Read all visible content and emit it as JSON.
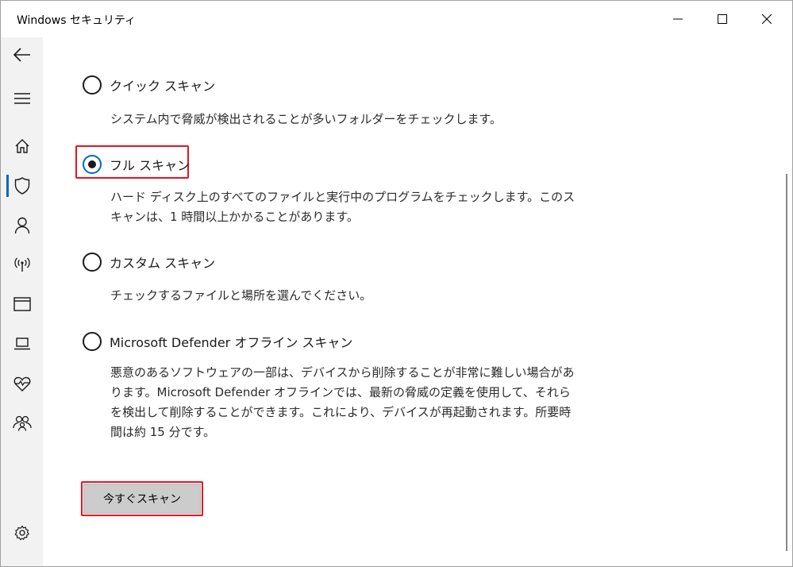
{
  "window": {
    "title": "Windows セキュリティ",
    "controls": [
      "minimize-icon",
      "maximize-icon",
      "close-icon"
    ]
  },
  "sidebar": {
    "items": [
      {
        "name": "back",
        "icon": "back-arrow-icon"
      },
      {
        "name": "menu",
        "icon": "hamburger-icon"
      },
      {
        "name": "home",
        "icon": "home-icon"
      },
      {
        "name": "virus-protection",
        "icon": "shield-icon",
        "active": true
      },
      {
        "name": "account-protection",
        "icon": "person-icon"
      },
      {
        "name": "firewall",
        "icon": "antenna-icon"
      },
      {
        "name": "app-browser-control",
        "icon": "browser-window-icon"
      },
      {
        "name": "device-security",
        "icon": "laptop-icon"
      },
      {
        "name": "device-performance",
        "icon": "heart-pulse-icon"
      },
      {
        "name": "family-options",
        "icon": "family-icon"
      },
      {
        "name": "settings",
        "icon": "gear-icon"
      }
    ],
    "accent": "#0067c0"
  },
  "scan_options": [
    {
      "label": "クイック スキャン",
      "description": "システム内で脅威が検出されることが多いフォルダーをチェックします。",
      "checked": false
    },
    {
      "label": "フル スキャン",
      "description": "ハード ディスク上のすべてのファイルと実行中のプログラムをチェックします。このスキャンは、1 時間以上かかることがあります。",
      "checked": true
    },
    {
      "label": "カスタム スキャン",
      "description": "チェックするファイルと場所を選んでください。",
      "checked": false
    },
    {
      "label": "Microsoft Defender オフライン スキャン",
      "description": "悪意のあるソフトウェアの一部は、デバイスから削除することが非常に難しい場合があります。Microsoft Defender オフラインでは、最新の脅威の定義を使用して、それらを検出して削除することができます。これにより、デバイスが再起動されます。所要時間は約 15 分です。",
      "checked": false
    }
  ],
  "actions": {
    "scan_now_label": "今すぐスキャン"
  },
  "highlight_color": "#e81123"
}
